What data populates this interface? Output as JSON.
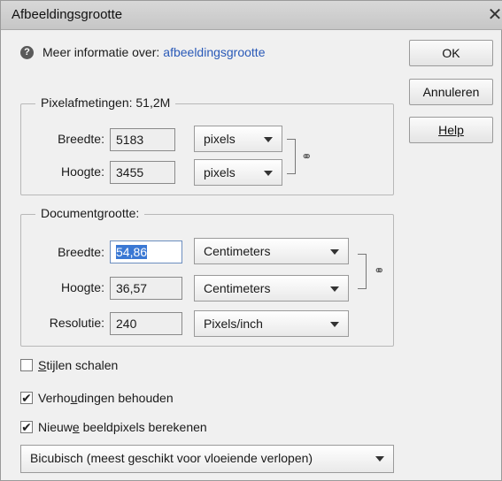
{
  "window": {
    "title": "Afbeeldingsgrootte",
    "close_glyph": "✕"
  },
  "info": {
    "icon": "question-icon",
    "icon_glyph": "?",
    "text": "Meer informatie over:",
    "link": "afbeeldingsgrootte"
  },
  "buttons": {
    "ok": "OK",
    "cancel": "Annuleren",
    "help": "Help"
  },
  "pixel_dimensions": {
    "legend": "Pixelafmetingen: 51,2M",
    "width_label": "Breedte:",
    "width_value": "5183",
    "width_unit": "pixels",
    "height_label": "Hoogte:",
    "height_value": "3455",
    "height_unit": "pixels"
  },
  "document_size": {
    "legend": "Documentgrootte:",
    "width_label": "Breedte:",
    "width_value": "54,86",
    "width_unit": "Centimeters",
    "height_label": "Hoogte:",
    "height_value": "36,57",
    "height_unit": "Centimeters",
    "resolution_label": "Resolutie:",
    "resolution_value": "240",
    "resolution_unit": "Pixels/inch"
  },
  "options": {
    "scale_styles": {
      "label_pre": "",
      "label_ul": "S",
      "label_post": "tijlen schalen",
      "checked": false
    },
    "constrain": {
      "label_pre": "Verho",
      "label_ul": "u",
      "label_post": "dingen behouden",
      "checked": true
    },
    "resample": {
      "label_pre": "Nieuw",
      "label_ul": "e",
      "label_post": " beeldpixels berekenen",
      "checked": true
    }
  },
  "resample_method": "Bicubisch (meest geschikt voor vloeiende verlopen)",
  "check_glyph": "✔"
}
